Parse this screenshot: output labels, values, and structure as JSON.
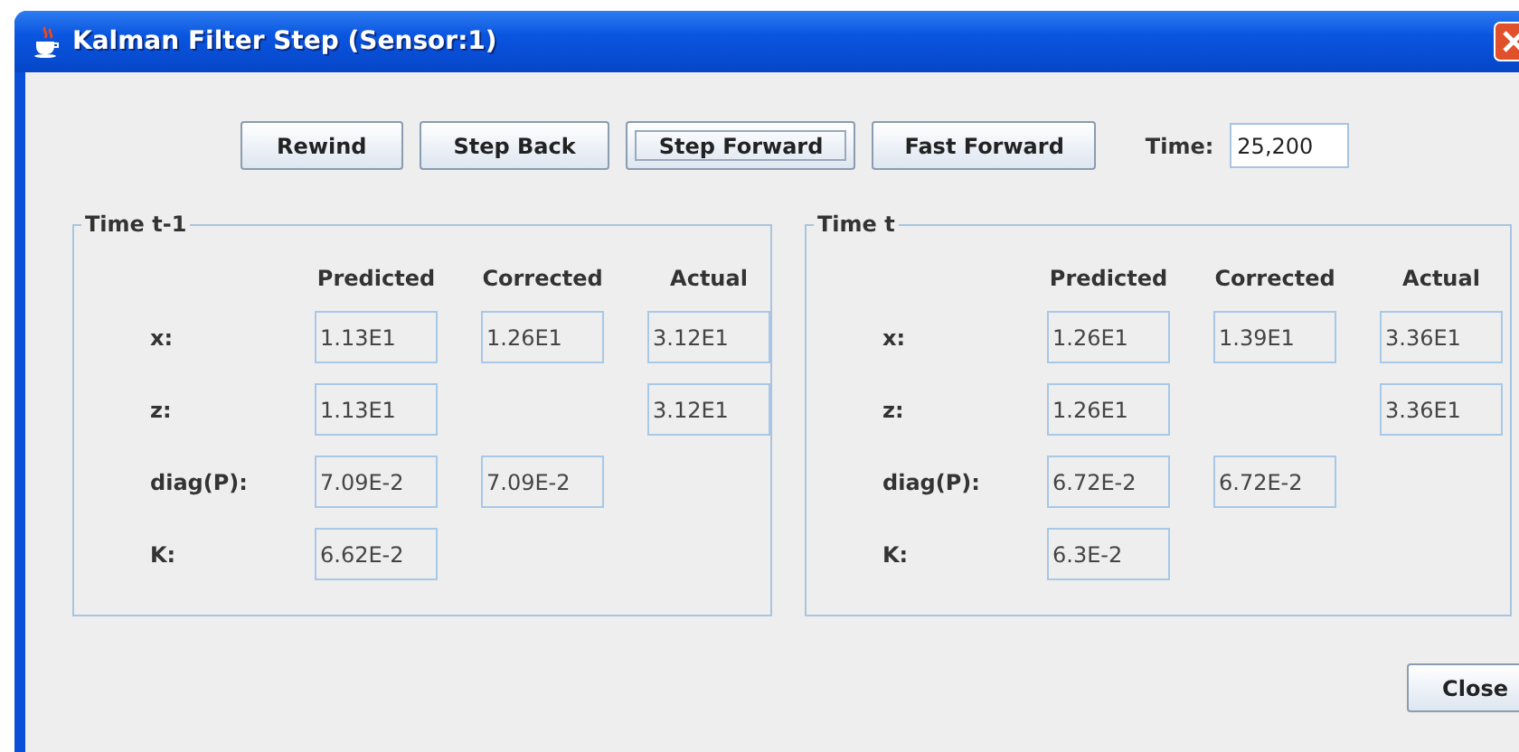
{
  "window": {
    "title": "Kalman Filter Step (Sensor:1)"
  },
  "toolbar": {
    "buttons": [
      {
        "label": "Rewind",
        "focused": false
      },
      {
        "label": "Step Back",
        "focused": false
      },
      {
        "label": "Step Forward",
        "focused": true
      },
      {
        "label": "Fast Forward",
        "focused": false
      }
    ],
    "time": {
      "label": "Time:",
      "value": "25,200"
    }
  },
  "panels": [
    {
      "title": "Time t-1",
      "columns": [
        "Predicted",
        "Corrected",
        "Actual"
      ],
      "rows": [
        {
          "label": "x:",
          "cells": [
            "1.13E1",
            "1.26E1",
            "3.12E1"
          ]
        },
        {
          "label": "z:",
          "cells": [
            "1.13E1",
            null,
            "3.12E1"
          ]
        },
        {
          "label": "diag(P):",
          "cells": [
            "7.09E-2",
            "7.09E-2",
            null
          ]
        },
        {
          "label": "K:",
          "cells": [
            "6.62E-2",
            null,
            null
          ]
        }
      ]
    },
    {
      "title": "Time t",
      "columns": [
        "Predicted",
        "Corrected",
        "Actual"
      ],
      "rows": [
        {
          "label": "x:",
          "cells": [
            "1.26E1",
            "1.39E1",
            "3.36E1"
          ]
        },
        {
          "label": "z:",
          "cells": [
            "1.26E1",
            null,
            "3.36E1"
          ]
        },
        {
          "label": "diag(P):",
          "cells": [
            "6.72E-2",
            "6.72E-2",
            null
          ]
        },
        {
          "label": "K:",
          "cells": [
            "6.3E-2",
            null,
            null
          ]
        }
      ]
    }
  ],
  "footer": {
    "buttons": [
      "Close"
    ]
  }
}
